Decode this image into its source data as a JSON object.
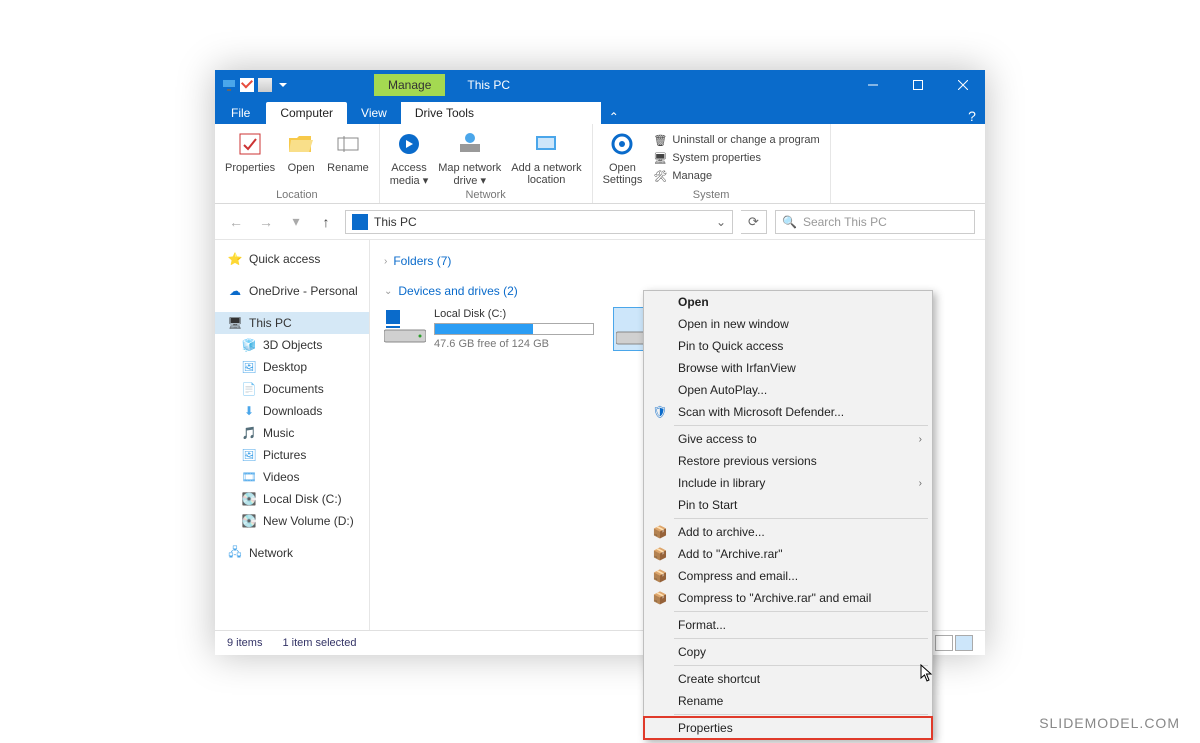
{
  "title": {
    "manage": "Manage",
    "window": "This PC"
  },
  "tabs": {
    "file": "File",
    "computer": "Computer",
    "view": "View",
    "drive_tools": "Drive Tools"
  },
  "ribbon": {
    "location_group": "Location",
    "properties": "Properties",
    "open": "Open",
    "rename": "Rename",
    "network_group": "Network",
    "access_media": "Access\nmedia ▾",
    "map_drive": "Map network\ndrive ▾",
    "add_location": "Add a network\nlocation",
    "system_group": "System",
    "open_settings": "Open\nSettings",
    "uninstall": "Uninstall or change a program",
    "sys_props": "System properties",
    "manage": "Manage"
  },
  "nav": {
    "path": "This PC"
  },
  "search": {
    "placeholder": "Search This PC"
  },
  "sidebar": {
    "quick_access": "Quick access",
    "onedrive": "OneDrive - Personal",
    "this_pc": "This PC",
    "objects3d": "3D Objects",
    "desktop": "Desktop",
    "documents": "Documents",
    "downloads": "Downloads",
    "music": "Music",
    "pictures": "Pictures",
    "videos": "Videos",
    "local_disk": "Local Disk (C:)",
    "new_volume": "New Volume (D:)",
    "network": "Network"
  },
  "content": {
    "folders_head": "Folders (7)",
    "devices_head": "Devices and drives (2)",
    "drive_c_name": "Local Disk (C:)",
    "drive_c_free": "47.6 GB free of 124 GB"
  },
  "status": {
    "items": "9 items",
    "selected": "1 item selected"
  },
  "menu": {
    "open": "Open",
    "open_new": "Open in new window",
    "pin_quick": "Pin to Quick access",
    "irfan": "Browse with IrfanView",
    "autoplay": "Open AutoPlay...",
    "defender": "Scan with Microsoft Defender...",
    "give_access": "Give access to",
    "restore": "Restore previous versions",
    "include": "Include in library",
    "pin_start": "Pin to Start",
    "archive_add": "Add to archive...",
    "archive_rar": "Add to \"Archive.rar\"",
    "compress_email": "Compress and email...",
    "compress_rar_email": "Compress to \"Archive.rar\" and email",
    "format": "Format...",
    "copy": "Copy",
    "create_shortcut": "Create shortcut",
    "rename": "Rename",
    "properties": "Properties"
  },
  "watermark": "SLIDEMODEL.COM"
}
